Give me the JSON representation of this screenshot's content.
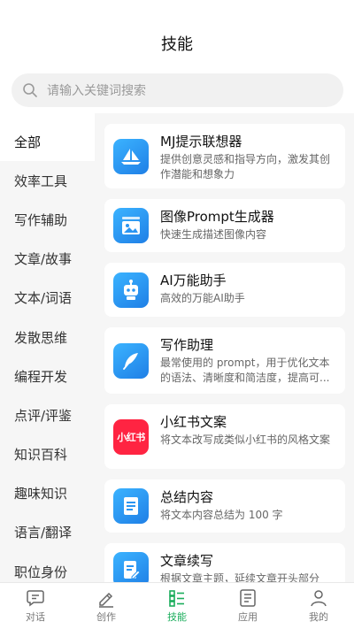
{
  "header": {
    "title": "技能"
  },
  "search": {
    "placeholder": "请输入关键词搜索"
  },
  "sidebar": {
    "active_index": 0,
    "items": [
      {
        "label": "全部"
      },
      {
        "label": "效率工具"
      },
      {
        "label": "写作辅助"
      },
      {
        "label": "文章/故事"
      },
      {
        "label": "文本/词语"
      },
      {
        "label": "发散思维"
      },
      {
        "label": "编程开发"
      },
      {
        "label": "点评/评鉴"
      },
      {
        "label": "知识百科"
      },
      {
        "label": "趣味知识"
      },
      {
        "label": "语言/翻译"
      },
      {
        "label": "职位身份"
      }
    ]
  },
  "skills": [
    {
      "name": "MJ提示联想器",
      "desc": "提供创意灵感和指导方向，激发其创作潜能和想象力",
      "icon": "sailboat-icon"
    },
    {
      "name": "图像Prompt生成器",
      "desc": "快速生成描述图像内容",
      "icon": "image-icon"
    },
    {
      "name": "AI万能助手",
      "desc": "高效的万能AI助手",
      "icon": "robot-icon"
    },
    {
      "name": "写作助理",
      "desc": "最常使用的 prompt，用于优化文本的语法、清晰度和简洁度，提高可...",
      "icon": "feather-icon"
    },
    {
      "name": "小红书文案",
      "desc": "将文本改写成类似小红书的风格文案",
      "icon": "xiaohongshu-logo",
      "logo_text": "小红书"
    },
    {
      "name": "总结内容",
      "desc": "将文本内容总结为 100 字",
      "icon": "document-icon"
    },
    {
      "name": "文章续写",
      "desc": "根据文章主题，延续文章开头部分",
      "icon": "edit-document-icon"
    }
  ],
  "tabbar": {
    "active_index": 2,
    "accent": "#1aad5b",
    "items": [
      {
        "label": "对话",
        "icon": "chat-icon"
      },
      {
        "label": "创作",
        "icon": "pen-icon"
      },
      {
        "label": "技能",
        "icon": "skill-list-icon"
      },
      {
        "label": "应用",
        "icon": "app-list-icon"
      },
      {
        "label": "我的",
        "icon": "profile-icon"
      }
    ]
  }
}
